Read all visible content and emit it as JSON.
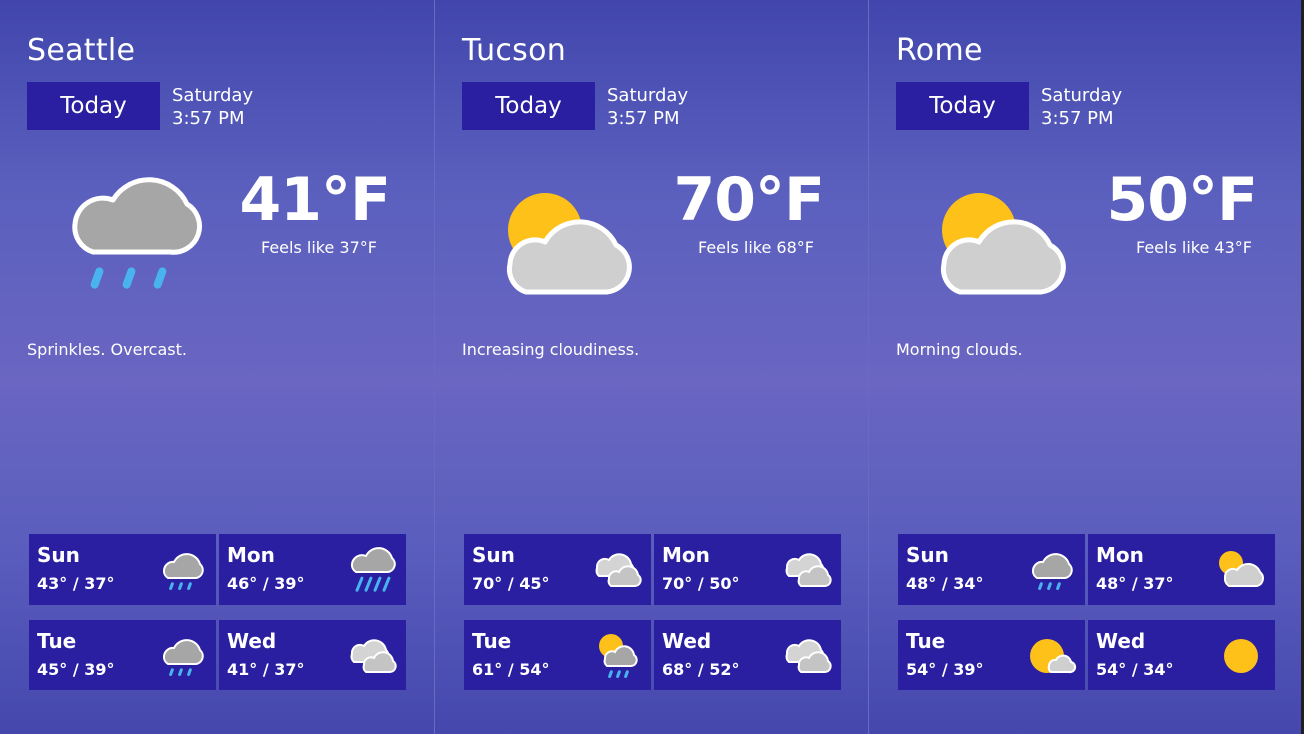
{
  "panels": [
    {
      "city": "Seattle",
      "today_label": "Today",
      "day": "Saturday",
      "time": "3:57 PM",
      "temp": "41°F",
      "feels_like": "Feels like 37°F",
      "summary": "Sprinkles. Overcast.",
      "icon": "rain-cloud-icon",
      "forecast": [
        {
          "day": "Sun",
          "range": "43° / 37°",
          "icon": "sprinkle-cloud-icon"
        },
        {
          "day": "Mon",
          "range": "46° / 39°",
          "icon": "heavy-rain-cloud-icon"
        },
        {
          "day": "Tue",
          "range": "45° / 39°",
          "icon": "sprinkle-cloud-icon"
        },
        {
          "day": "Wed",
          "range": "41° / 37°",
          "icon": "cloudy-icon"
        }
      ]
    },
    {
      "city": "Tucson",
      "today_label": "Today",
      "day": "Saturday",
      "time": "3:57 PM",
      "temp": "70°F",
      "feels_like": "Feels like 68°F",
      "summary": "Increasing cloudiness.",
      "icon": "partly-cloudy-icon",
      "forecast": [
        {
          "day": "Sun",
          "range": "70° / 45°",
          "icon": "cloudy-icon"
        },
        {
          "day": "Mon",
          "range": "70° / 50°",
          "icon": "cloudy-icon"
        },
        {
          "day": "Tue",
          "range": "61° / 54°",
          "icon": "sun-rain-cloud-icon"
        },
        {
          "day": "Wed",
          "range": "68° / 52°",
          "icon": "cloudy-icon"
        }
      ]
    },
    {
      "city": "Rome",
      "today_label": "Today",
      "day": "Saturday",
      "time": "3:57 PM",
      "temp": "50°F",
      "feels_like": "Feels like 43°F",
      "summary": "Morning clouds.",
      "icon": "partly-cloudy-icon",
      "forecast": [
        {
          "day": "Sun",
          "range": "48° / 34°",
          "icon": "sprinkle-cloud-icon"
        },
        {
          "day": "Mon",
          "range": "48° / 37°",
          "icon": "partly-cloudy-icon"
        },
        {
          "day": "Tue",
          "range": "54° / 39°",
          "icon": "mostly-sunny-icon"
        },
        {
          "day": "Wed",
          "range": "54° / 34°",
          "icon": "sunny-icon"
        }
      ]
    }
  ],
  "colors": {
    "button_bg": "#2a1fa0",
    "sun": "#fdc11a",
    "cloud_light": "#cfcfcf",
    "cloud_dark": "#a6a6a6",
    "rain": "#49b3f0"
  }
}
